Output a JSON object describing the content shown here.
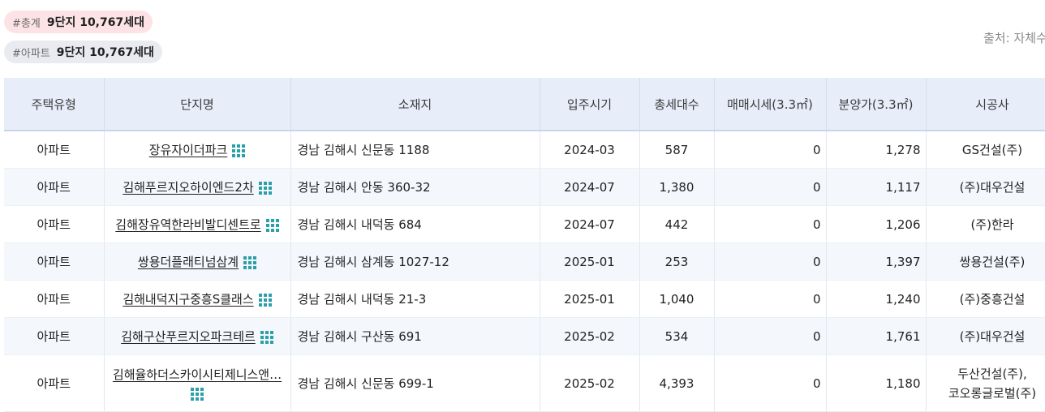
{
  "summary": {
    "total_tag": "#총계",
    "total_value": "9단지 10,767세대",
    "apt_tag": "#아파트",
    "apt_value": "9단지 10,767세대"
  },
  "source": "출처: 자체수",
  "table": {
    "headers": [
      "주택유형",
      "단지명",
      "소재지",
      "입주시기",
      "총세대수",
      "매매시세(3.3㎡)",
      "분양가(3.3㎡)",
      "시공사"
    ],
    "rows": [
      {
        "type": "아파트",
        "name": "장유자이더파크",
        "address": "경남 김해시 신문동 1188",
        "move_in": "2024-03",
        "households": "587",
        "trade": "0",
        "sale": "1,278",
        "builder": "GS건설(주)"
      },
      {
        "type": "아파트",
        "name": "김해푸르지오하이엔드2차",
        "address": "경남 김해시 안동 360-32",
        "move_in": "2024-07",
        "households": "1,380",
        "trade": "0",
        "sale": "1,117",
        "builder": "(주)대우건설"
      },
      {
        "type": "아파트",
        "name": "김해장유역한라비발디센트로",
        "address": "경남 김해시 내덕동 684",
        "move_in": "2024-07",
        "households": "442",
        "trade": "0",
        "sale": "1,206",
        "builder": "(주)한라"
      },
      {
        "type": "아파트",
        "name": "쌍용더플래티넘삼계",
        "address": "경남 김해시 삼계동 1027-12",
        "move_in": "2025-01",
        "households": "253",
        "trade": "0",
        "sale": "1,397",
        "builder": "쌍용건설(주)"
      },
      {
        "type": "아파트",
        "name": "김해내덕지구중흥S클래스",
        "address": "경남 김해시 내덕동 21-3",
        "move_in": "2025-01",
        "households": "1,040",
        "trade": "0",
        "sale": "1,240",
        "builder": "(주)중흥건설"
      },
      {
        "type": "아파트",
        "name": "김해구산푸르지오파크테르",
        "address": "경남 김해시 구산동 691",
        "move_in": "2025-02",
        "households": "534",
        "trade": "0",
        "sale": "1,761",
        "builder": "(주)대우건설"
      },
      {
        "type": "아파트",
        "name": "김해율하더스카이시티제니스앤…",
        "address": "경남 김해시 신문동 699-1",
        "move_in": "2025-02",
        "households": "4,393",
        "trade": "0",
        "sale": "1,180",
        "builder_lines": [
          "두산건설(주),",
          "코오롱글로벌(주)"
        ]
      }
    ]
  }
}
